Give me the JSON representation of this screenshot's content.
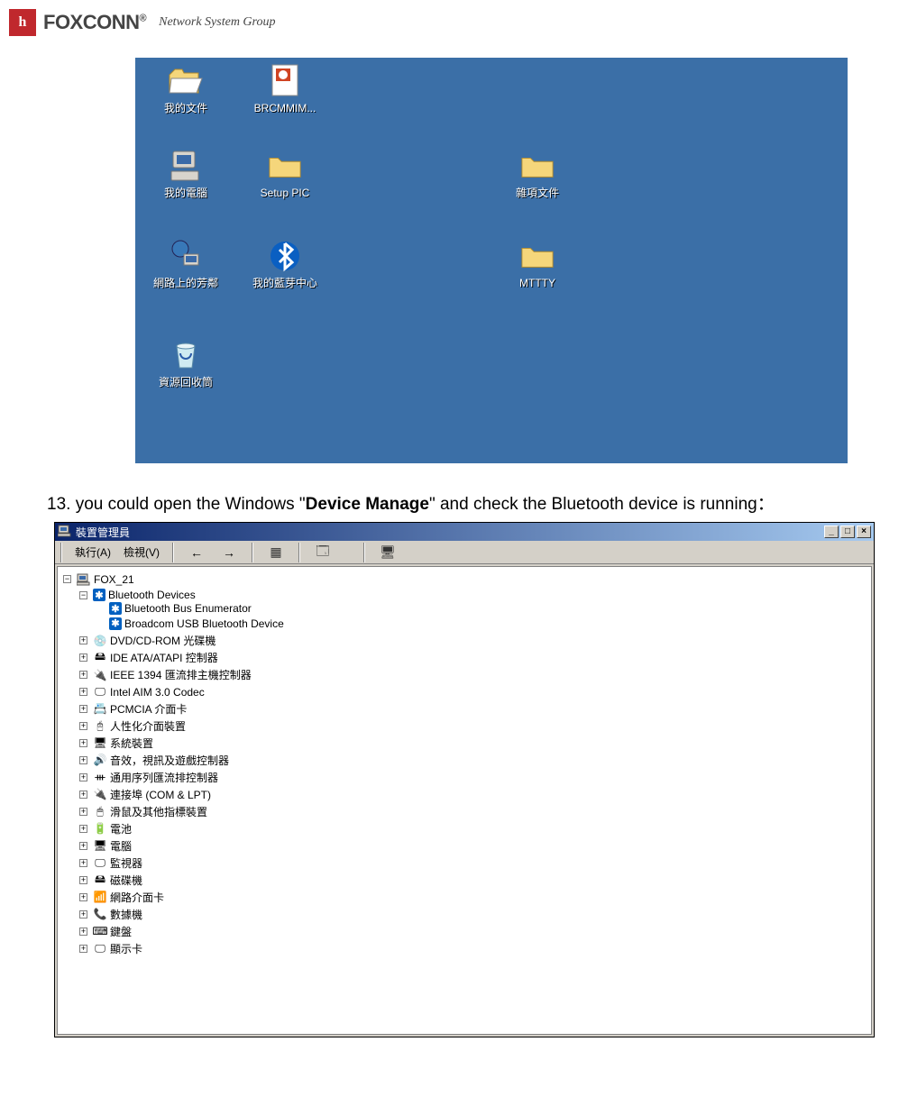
{
  "header": {
    "logo_mark": "h",
    "brand": "FOXCONN",
    "reg": "®",
    "subtitle": "Network System Group"
  },
  "desktop": {
    "icons": {
      "my_docs": "我的文件",
      "brcmmim": "BRCMMIM...",
      "my_computer": "我的電腦",
      "setup_pic": "Setup PIC",
      "misc_files": "雜項文件",
      "network_places": "網路上的芳鄰",
      "my_bluetooth": "我的藍芽中心",
      "mttty": "MTTTY",
      "recycle_bin": "資源回收筒"
    }
  },
  "instruction": {
    "num": "13.",
    "pre": " you could open the Windows \"",
    "bold": "Device Manage",
    "post": "\" and check the Bluetooth device is running："
  },
  "dm": {
    "title": "裝置管理員",
    "menu": {
      "action": "執行(A)",
      "view": "檢視(V)"
    },
    "win_btns": {
      "min": "_",
      "max": "□",
      "close": "×"
    },
    "tree": {
      "root": "FOX_21",
      "bt_devices": "Bluetooth Devices",
      "bt_bus": "Bluetooth Bus Enumerator",
      "bt_broadcom": "Broadcom USB Bluetooth Device",
      "dvd": "DVD/CD-ROM 光碟機",
      "ide": "IDE ATA/ATAPI 控制器",
      "ieee": "IEEE 1394 匯流排主機控制器",
      "intel_aim": "Intel AIM 3.0 Codec",
      "pcmcia": "PCMCIA 介面卡",
      "hid": "人性化介面裝置",
      "system_dev": "系統裝置",
      "sound": "音效，視訊及遊戲控制器",
      "usb": "通用序列匯流排控制器",
      "ports": "連接埠 (COM & LPT)",
      "mouse": "滑鼠及其他指標裝置",
      "battery": "電池",
      "computer": "電腦",
      "monitor": "監視器",
      "disk": "磁碟機",
      "network": "網路介面卡",
      "modem": "數據機",
      "keyboard": "鍵盤",
      "display": "顯示卡"
    }
  }
}
